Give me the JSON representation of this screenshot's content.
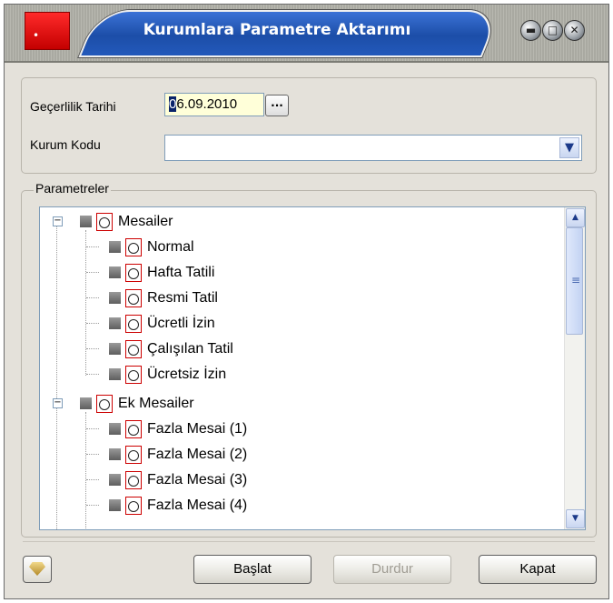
{
  "window": {
    "title": "Kurumlara Parametre Aktarımı"
  },
  "form": {
    "validity_date_label": "Geçerlilik Tarihi",
    "validity_date_value": "06.09.2010",
    "ellipsis_label": "...",
    "institution_code_label": "Kurum Kodu",
    "institution_code_value": ""
  },
  "parameters": {
    "group_label": "Parametreler",
    "tree": [
      {
        "label": "Mesailer",
        "children": [
          "Normal",
          "Hafta Tatili",
          "Resmi Tatil",
          "Ücretli İzin",
          "Çalışılan Tatil",
          "Ücretsiz İzin"
        ]
      },
      {
        "label": "Ek Mesailer",
        "children": [
          "Fazla Mesai (1)",
          "Fazla Mesai (2)",
          "Fazla Mesai (3)",
          "Fazla Mesai (4)"
        ]
      }
    ]
  },
  "buttons": {
    "start": "Başlat",
    "stop": "Durdur",
    "close": "Kapat"
  },
  "icons": [
    "app-icon",
    "minimize-icon",
    "maximize-icon",
    "close-icon",
    "dropdown-arrow-icon",
    "clock-icon",
    "gem-icon"
  ]
}
